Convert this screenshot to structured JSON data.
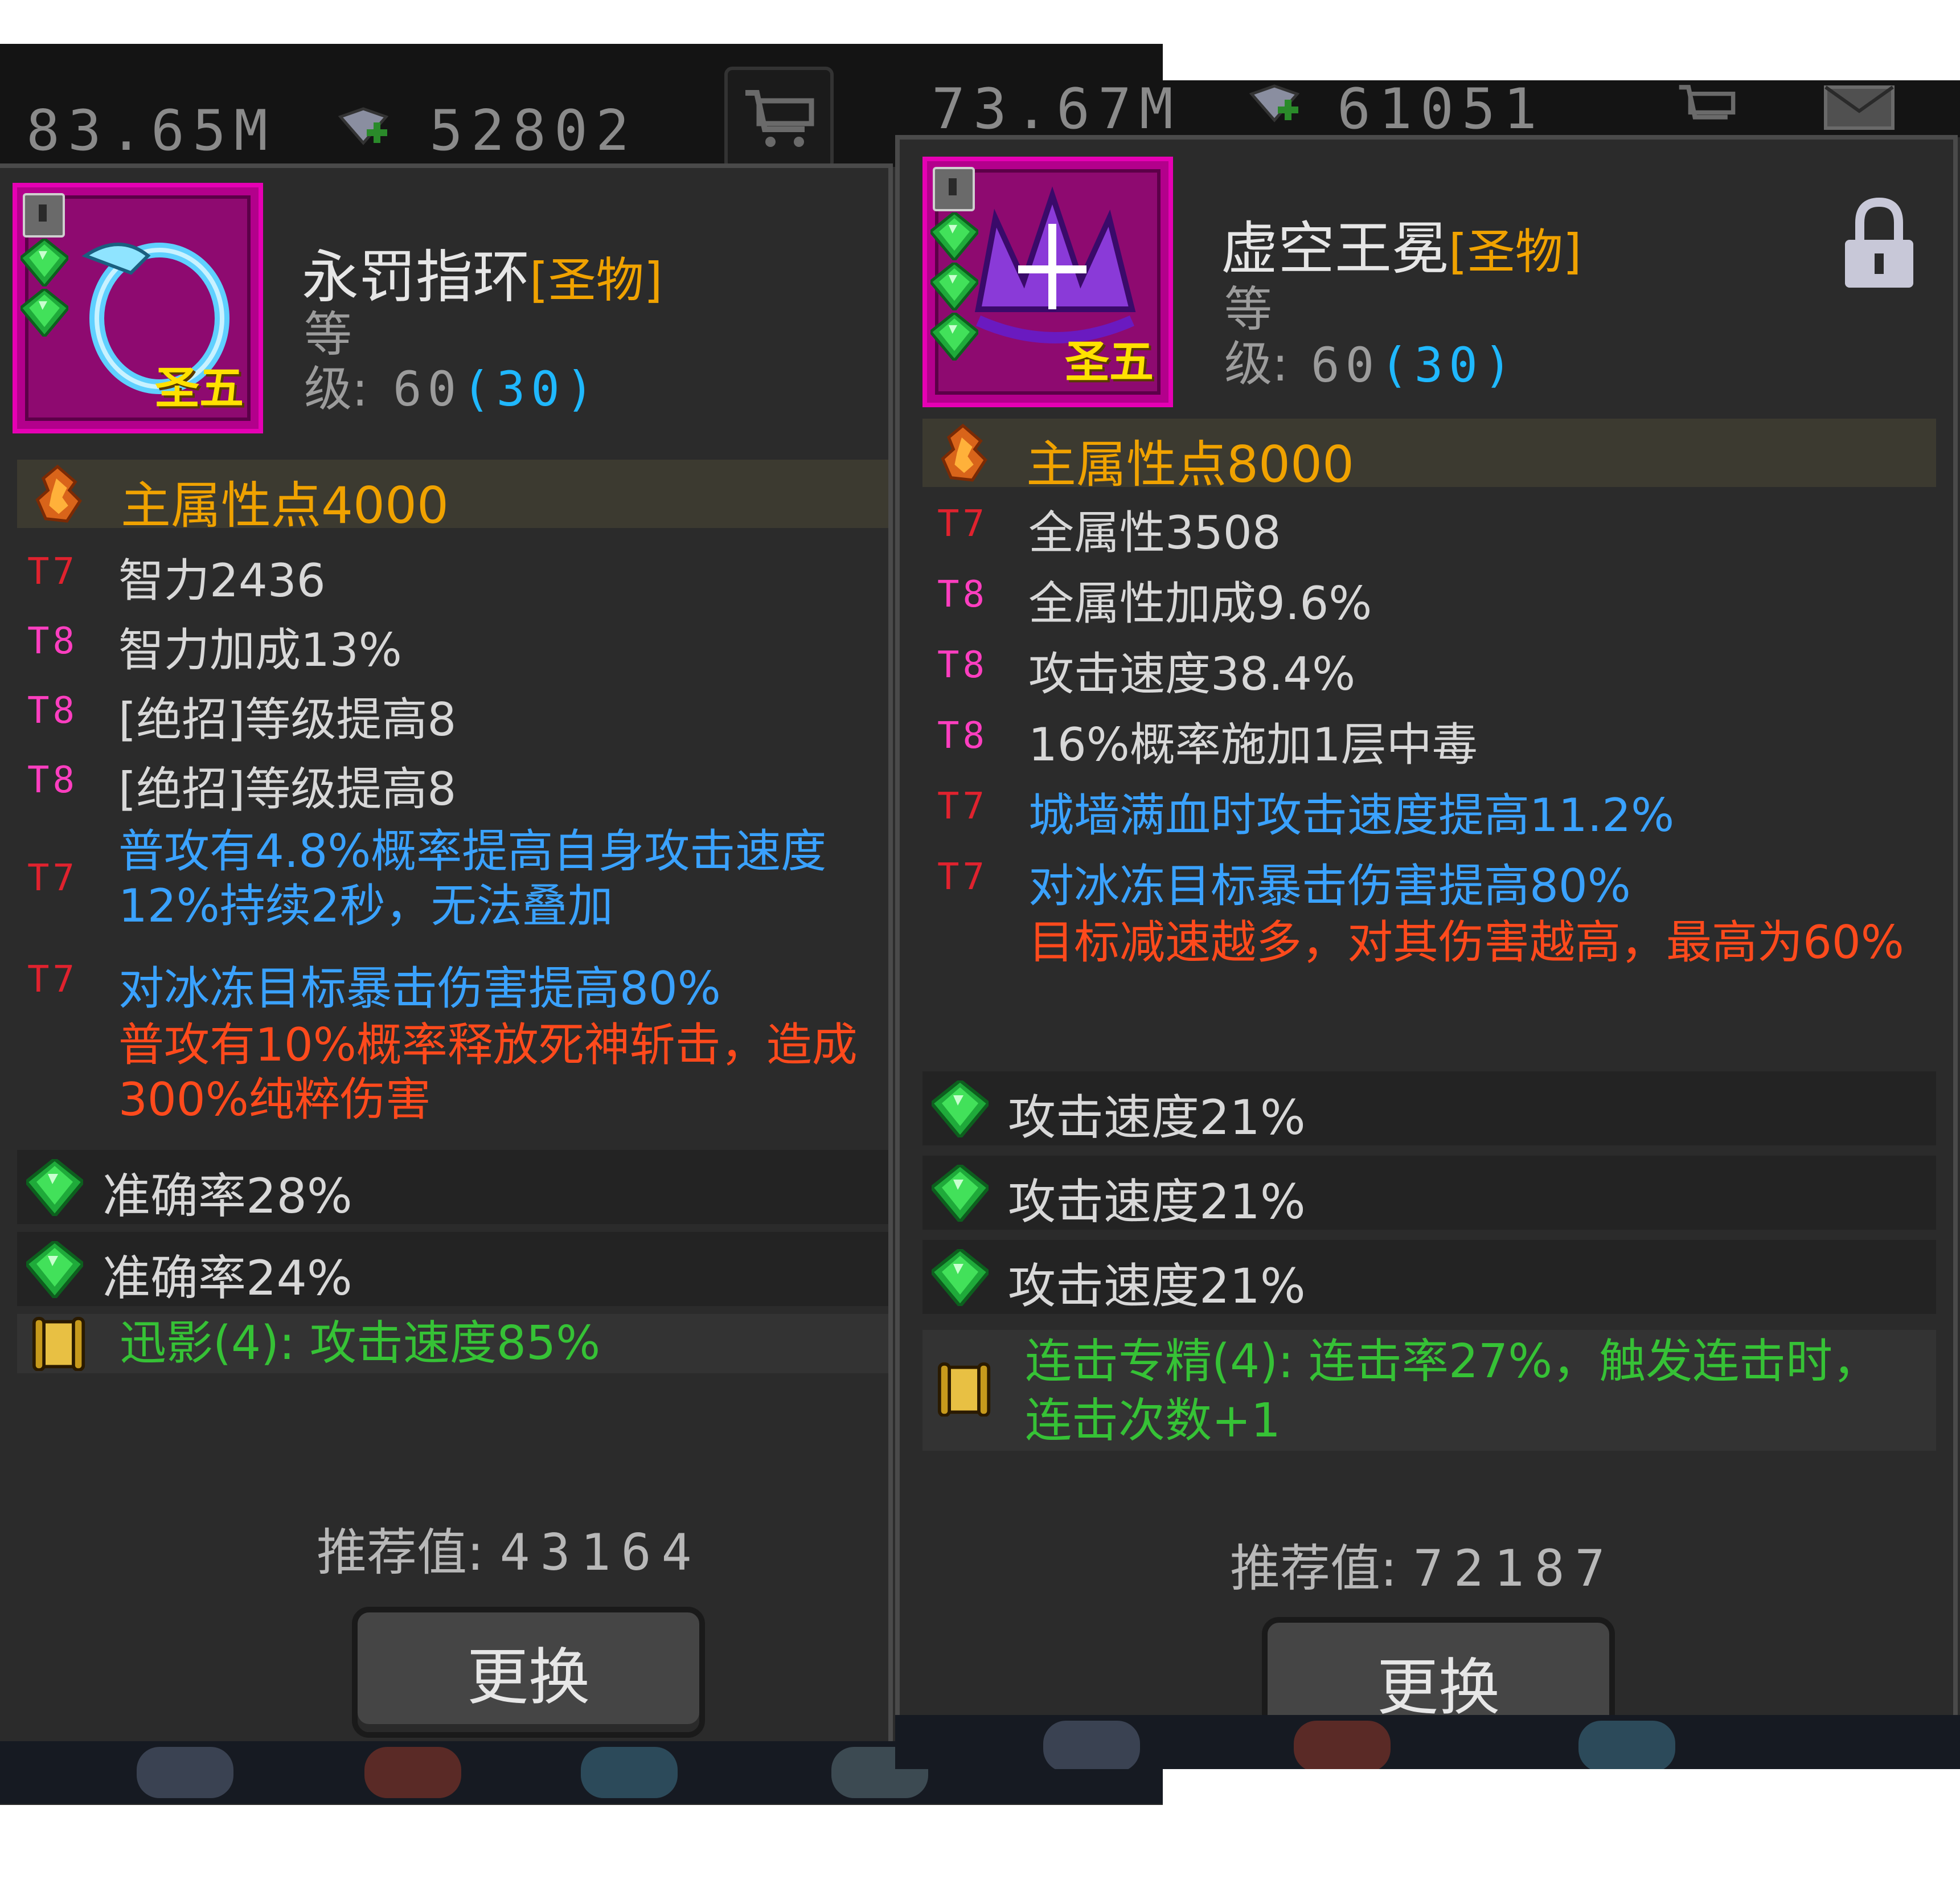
{
  "left": {
    "resources": {
      "gold": "83.65M",
      "gems": "52802"
    },
    "item": {
      "name": "永罚指环",
      "quality": "[圣物]",
      "rank": "圣五",
      "level_label": "等级:",
      "level_value": "60",
      "level_bonus": "(30)"
    },
    "main_attr": "主属性点4000",
    "attributes": [
      {
        "tier": "T7",
        "text": "智力2436"
      },
      {
        "tier": "T8",
        "text": "智力加成13%"
      },
      {
        "tier": "T8",
        "text": "[绝招]等级提高8"
      },
      {
        "tier": "T8",
        "text": "[绝招]等级提高8"
      },
      {
        "tier": "T7",
        "text": "普攻有4.8%概率提高自身攻击速度12%持续2秒，无法叠加"
      },
      {
        "tier": "T7",
        "text": "对冰冻目标暴击伤害提高80%"
      }
    ],
    "special": "普攻有10%概率释放死神斩击，造成300%纯粹伤害",
    "gem_stats": [
      "准确率28%",
      "准确率24%"
    ],
    "set_bonus": "迅影(4): 攻击速度85%",
    "recommend_label": "推荐值:",
    "recommend_value": "43164",
    "button_label": "更换"
  },
  "right": {
    "resources": {
      "gold": "73.67M",
      "gems": "61051"
    },
    "item": {
      "name": "虚空王冕",
      "quality": "[圣物]",
      "rank": "圣五",
      "level_label": "等级:",
      "level_value": "60",
      "level_bonus": "(30)"
    },
    "main_attr": "主属性点8000",
    "attributes": [
      {
        "tier": "T7",
        "text": "全属性3508"
      },
      {
        "tier": "T8",
        "text": "全属性加成9.6%"
      },
      {
        "tier": "T8",
        "text": "攻击速度38.4%"
      },
      {
        "tier": "T8",
        "text": "16%概率施加1层中毒"
      },
      {
        "tier": "T7",
        "text": "城墙满血时攻击速度提高11.2%"
      },
      {
        "tier": "T7",
        "text": "对冰冻目标暴击伤害提高80%"
      }
    ],
    "special": "目标减速越多，对其伤害越高，最高为60%",
    "gem_stats": [
      "攻击速度21%",
      "攻击速度21%",
      "攻击速度21%"
    ],
    "set_bonus": "连击专精(4): 连击率27%，触发连击时，连击次数+1",
    "recommend_label": "推荐值:",
    "recommend_value": "72187",
    "button_label": "更换"
  },
  "colors": {
    "panel_bg": "#2b2b2b",
    "main_attr": "#f0a200",
    "tier_t7": "#e0222e",
    "tier_t8": "#ff3ec0",
    "effect_blue": "#3aa2ff",
    "special_red": "#ff4a1c",
    "set_green": "#36c236",
    "icon_frame": "#e600b4"
  },
  "icons": [
    "gem-plus-icon",
    "shop-cart-icon",
    "mail-icon",
    "lock-icon",
    "fire-orb-icon",
    "green-gem-icon",
    "scroll-icon",
    "ring-icon",
    "crown-icon"
  ]
}
